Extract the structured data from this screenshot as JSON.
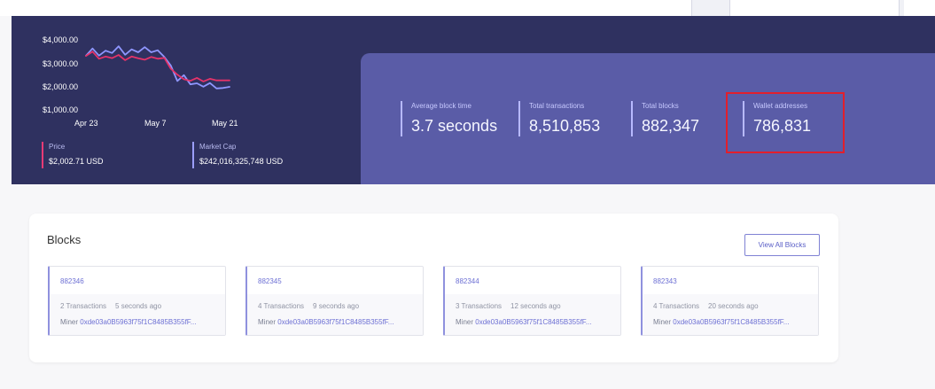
{
  "chart": {
    "y_ticks": [
      "$4,000.00",
      "$3,000.00",
      "$2,000.00",
      "$1,000.00"
    ],
    "x_ticks": [
      "Apr 23",
      "May 7",
      "May 21"
    ]
  },
  "chart_data": {
    "type": "line",
    "title": "",
    "xlabel": "",
    "ylabel": "",
    "categories": [
      "Apr 23",
      "May 7",
      "May 21"
    ],
    "ylim": [
      1000,
      4000
    ],
    "series": [
      {
        "name": "Price",
        "color": "#e5336a",
        "values": [
          3090,
          3280,
          2960,
          3060,
          2990,
          3130,
          2900,
          3060,
          2980,
          2920,
          3040,
          2960,
          3000,
          2520,
          2250,
          2050,
          1980,
          2110,
          1950,
          2070,
          2000,
          2000,
          2000
        ]
      },
      {
        "name": "Market Cap",
        "color": "#8f96ff",
        "values": [
          3100,
          3420,
          3100,
          3320,
          3220,
          3520,
          3140,
          3380,
          3250,
          3480,
          3250,
          3340,
          3040,
          2660,
          1970,
          2230,
          1820,
          1870,
          1720,
          1880,
          1640,
          1660,
          1710
        ]
      }
    ]
  },
  "tickers": [
    {
      "label": "Price",
      "value": "$2,002.71 USD",
      "color": "#e83b75"
    },
    {
      "label": "Market Cap",
      "value": "$242,016,325,748 USD",
      "color": "#9b9efc"
    }
  ],
  "stats": [
    {
      "label": "Average block time",
      "value": "3.7 seconds"
    },
    {
      "label": "Total transactions",
      "value": "8,510,853"
    },
    {
      "label": "Total blocks",
      "value": "882,347"
    },
    {
      "label": "Wallet addresses",
      "value": "786,831"
    }
  ],
  "blocks": {
    "title": "Blocks",
    "view_all": "View All Blocks",
    "miner_label": "Miner",
    "items": [
      {
        "number": "882346",
        "transactions": "2 Transactions",
        "age": "5 seconds ago",
        "miner": "0xde03a0B5963f75f1C8485B355fF..."
      },
      {
        "number": "882345",
        "transactions": "4 Transactions",
        "age": "9 seconds ago",
        "miner": "0xde03a0B5963f75f1C8485B355fF..."
      },
      {
        "number": "882344",
        "transactions": "3 Transactions",
        "age": "12 seconds ago",
        "miner": "0xde03a0B5963f75f1C8485B355fF..."
      },
      {
        "number": "882343",
        "transactions": "4 Transactions",
        "age": "20 seconds ago",
        "miner": "0xde03a0B5963f75f1C8485B355fF..."
      }
    ]
  },
  "colors": {
    "dashboard": "#2f3160",
    "stats_panel": "#5a5ca7",
    "highlight": "#e21f2c",
    "link": "#6d70d4"
  }
}
